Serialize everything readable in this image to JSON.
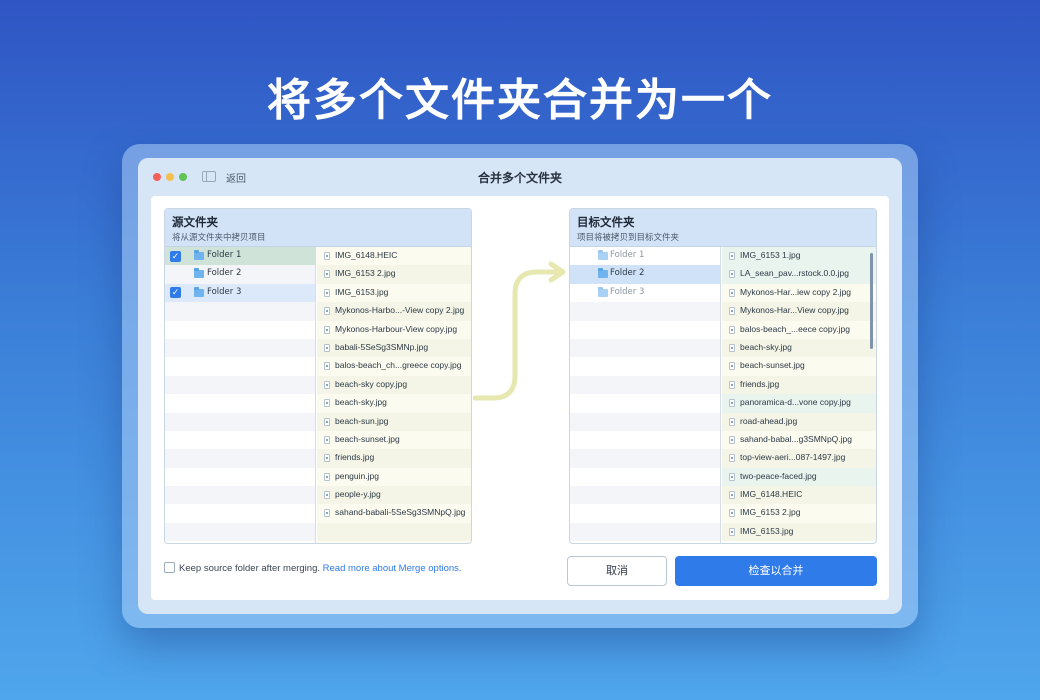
{
  "hero": {
    "title": "将多个文件夹合并为一个"
  },
  "window": {
    "title": "合并多个文件夹",
    "back_label": "返回"
  },
  "source": {
    "title": "源文件夹",
    "subtitle": "将从源文件夹中拷贝项目",
    "folders": [
      {
        "label": "Folder 1",
        "checked": true
      },
      {
        "label": "Folder 2",
        "checked": false
      },
      {
        "label": "Folder 3",
        "checked": true
      }
    ],
    "files": [
      "IMG_6148.HEIC",
      "IMG_6153 2.jpg",
      "IMG_6153.jpg",
      "Mykonos-Harbo...-View copy 2.jpg",
      "Mykonos-Harbour-View copy.jpg",
      "babali-5SeSg3SMNp.jpg",
      "balos-beach_ch...greece copy.jpg",
      "beach-sky copy.jpg",
      "beach-sky.jpg",
      "beach-sun.jpg",
      "beach-sunset.jpg",
      "friends.jpg",
      "penguin.jpg",
      "people-y.jpg",
      "sahand-babali-5SeSg3SMNpQ.jpg"
    ]
  },
  "target": {
    "title": "目标文件夹",
    "subtitle": "项目将被拷贝到目标文件夹",
    "folders": [
      {
        "label": "Folder 1"
      },
      {
        "label": "Folder 2"
      },
      {
        "label": "Folder 3"
      }
    ],
    "files": [
      "IMG_6153 1.jpg",
      "LA_sean_pav...rstock.0.0.jpg",
      "Mykonos-Har...iew copy 2.jpg",
      "Mykonos-Har...View copy.jpg",
      "balos-beach_...eece copy.jpg",
      "beach-sky.jpg",
      "beach-sunset.jpg",
      "friends.jpg",
      "panoramica-d...vone copy.jpg",
      "road-ahead.jpg",
      "sahand-babal...g3SMNpQ.jpg",
      "top-view-aeri...087-1497.jpg",
      "two-peace-faced.jpg",
      "IMG_6148.HEIC",
      "IMG_6153 2.jpg",
      "IMG_6153.jpg"
    ]
  },
  "footer": {
    "keep_label": "Keep source folder after merging.",
    "read_more": "Read more about Merge options.",
    "cancel_label": "取消",
    "merge_label": "检查以合并"
  },
  "colors": {
    "accent": "#2f7be9",
    "arrow": "#e6e8b0"
  }
}
